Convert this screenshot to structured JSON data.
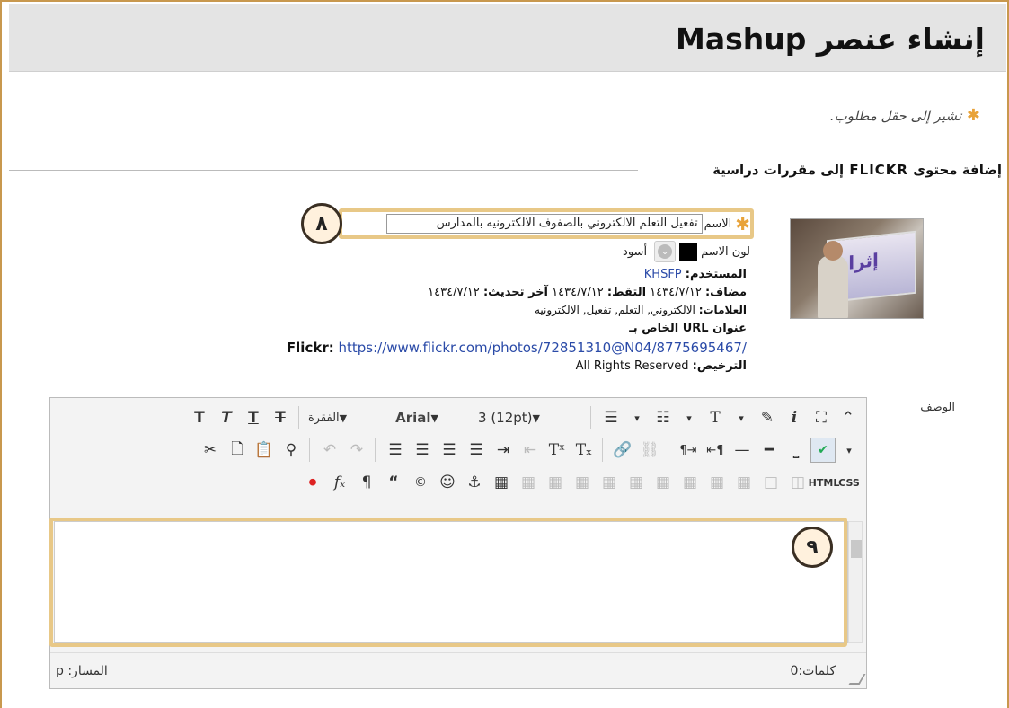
{
  "header": {
    "title": "إنشاء عنصر Mashup"
  },
  "required_note": "تشير إلى حقل مطلوب.",
  "section": {
    "title": "إضافة محتوى FLICKR إلى مقررات دراسية"
  },
  "thumbnail": {
    "text": "إثراء"
  },
  "form": {
    "name_label": "الاسم",
    "name_value": "تفعيل التعلم الالكتروني بالصفوف الالكترونيه بالمدارس",
    "color_label": "لون الاسم",
    "color_value": "أسود",
    "name_color": "#000000"
  },
  "meta": {
    "user_label": "المستخدم:",
    "user_value": "KHSFP",
    "added_label": "مضاف:",
    "added_value": "١٤٣٤/٧/١٢",
    "taken_label": "التقط:",
    "taken_value": "١٤٣٤/٧/١٢",
    "updated_label": "آخر تحديث:",
    "updated_value": "١٤٣٤/٧/١٢",
    "tags_label": "العلامات:",
    "tags_value": "الالكتروني, التعلم, تفعيل, الالكترونيه",
    "url_label": "عنوان URL الخاص بـ",
    "url_site": "Flickr:",
    "url_value": "https://www.flickr.com/photos/72851310@N04/8775695467/",
    "license_label": "الترخيص:",
    "license_value": "All Rights Reserved"
  },
  "editor": {
    "description_label": "الوصف",
    "paragraph_select": "الفقرة",
    "font_select": "Arial",
    "size_select": "3 (12pt)",
    "path_label": "المسار: p",
    "words_label": "كلمات:0"
  },
  "annotations": {
    "badge_8": "٨",
    "badge_9": "٩",
    "highlight_color": "#e8c887"
  }
}
